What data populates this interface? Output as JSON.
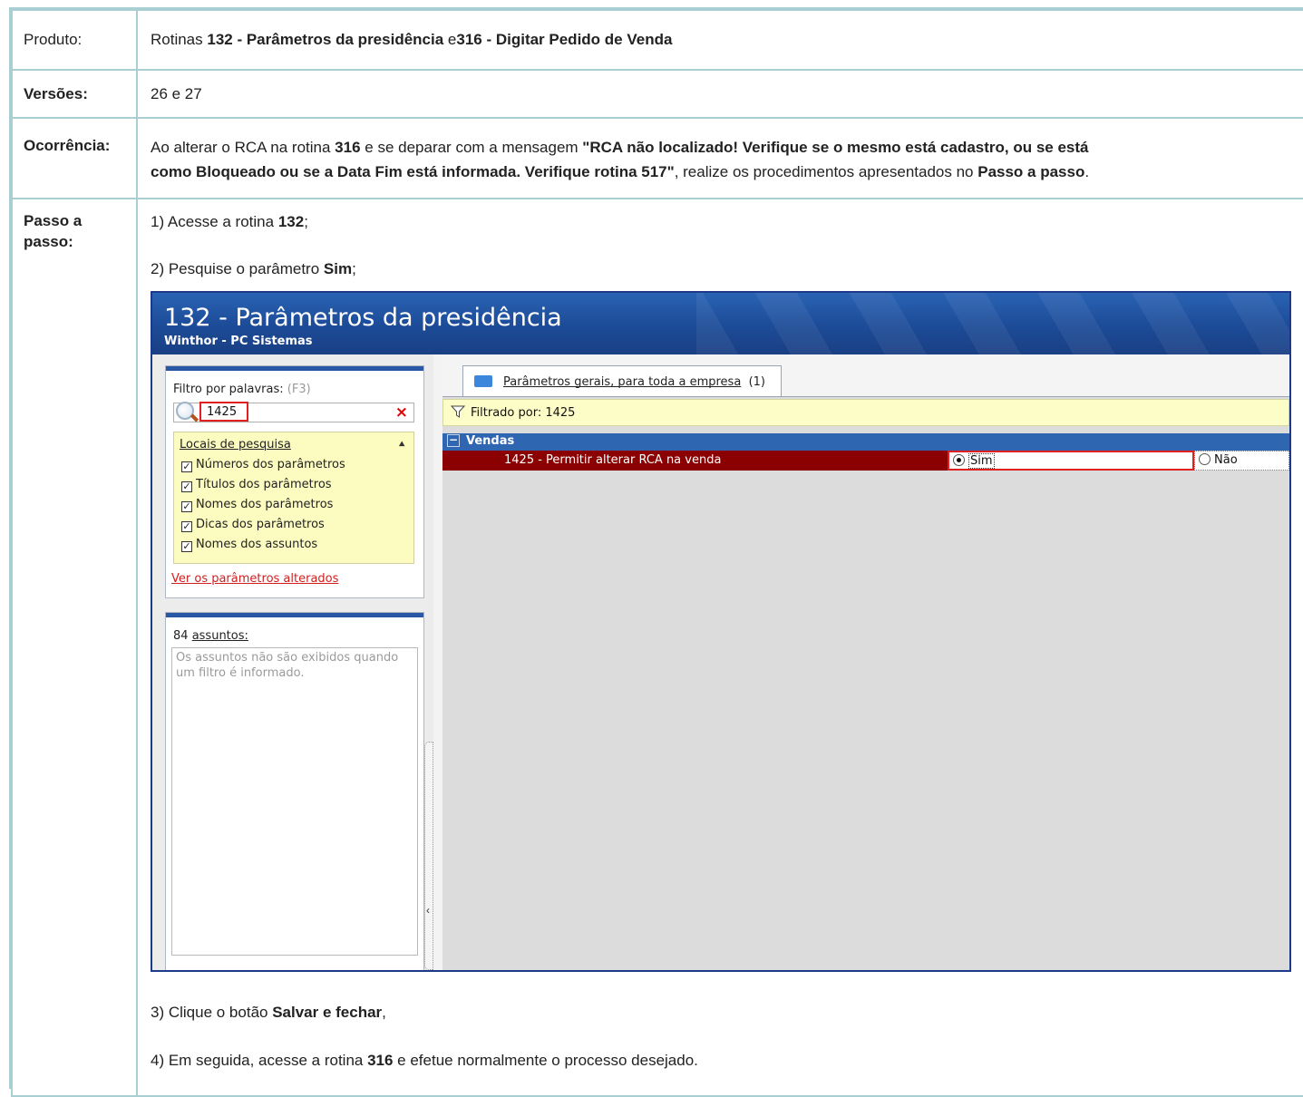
{
  "rows": {
    "produto": {
      "label": "Produto:",
      "pre": "Rotinas ",
      "b1": "132 - Parâmetros da presidência",
      "mid": " e",
      "b2": "316 - Digitar Pedido de Venda"
    },
    "versoes": {
      "label": "Versões:",
      "value": "26 e 27"
    },
    "ocorrencia": {
      "label": "Ocorrência:",
      "t1": "Ao alterar o RCA na rotina ",
      "b1": "316",
      "t2": " e se deparar com a mensagem ",
      "b2a": "\"RCA não localizado!  Verifique se o mesmo está cadastro, ou se está",
      "b2b": "como Bloqueado ou se a Data Fim está informada. Verifique rotina 517\"",
      "t3": ", realize os procedimentos apresentados no ",
      "b3": "Passo a passo",
      "t4": "."
    },
    "passo": {
      "label1": "Passo a",
      "label2": "passo:",
      "s1_text": "1) Acesse a rotina ",
      "s1_bold": "132",
      "s1_end": ";",
      "s2_text": "2) Pesquise o parâmetro ",
      "s2_bold": "Sim",
      "s2_end": ";",
      "s3_text": "3) Clique o botão ",
      "s3_bold": "Salvar e fechar",
      "s3_end": ",",
      "s4_text": "4) Em seguida, acesse a rotina ",
      "s4_bold": "316",
      "s4_end": " e efetue normalmente o processo desejado."
    }
  },
  "screenshot": {
    "title": "132 - Parâmetros da presidência",
    "subtitle": "Winthor - PC Sistemas",
    "filter_label": "Filtro por palavras:",
    "filter_hint": "(F3)",
    "search_value": "1425",
    "clear_icon": "×",
    "locais_header": "Locais de pesquisa",
    "locais_items": [
      "Números dos parâmetros",
      "Títulos dos parâmetros",
      "Nomes dos parâmetros",
      "Dicas dos parâmetros",
      "Nomes dos assuntos"
    ],
    "ver_link": "Ver os parâmetros alterados",
    "assuntos_count": "84",
    "assuntos_word": "assuntos:",
    "assuntos_msg": "Os assuntos não são exibidos quando um filtro é informado.",
    "tab_label": "Parâmetros gerais, para toda a empresa",
    "tab_count": "(1)",
    "filtered_by": "Filtrado por: 1425",
    "group_name": "Vendas",
    "param_name": "1425 - Permitir alterar RCA na venda",
    "option_sim": "Sim",
    "option_nao": "Não",
    "colors": {
      "header_blue": "#1c4b97",
      "selected_row": "#8b0000",
      "highlight_red": "#e02020"
    }
  }
}
